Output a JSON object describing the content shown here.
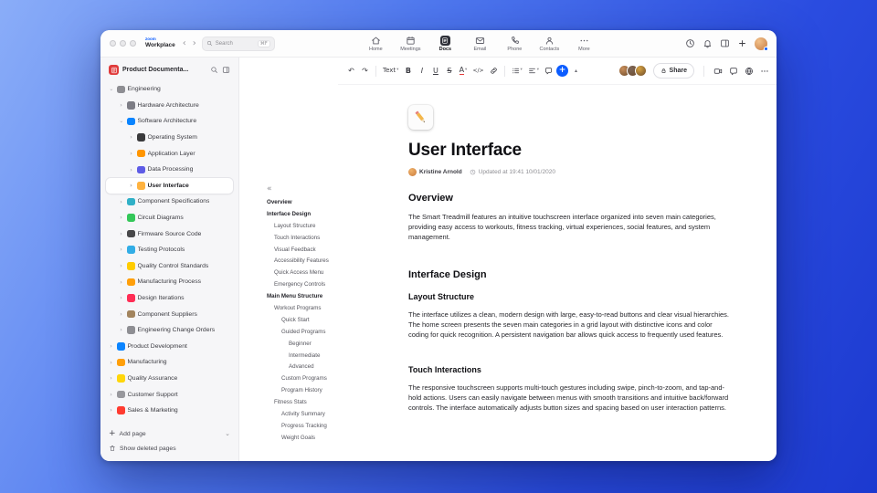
{
  "titlebar": {
    "brand_top": "zoom",
    "brand_bottom": "Workplace",
    "search_label": "Search",
    "search_shortcut": "⌘F",
    "tabs": [
      {
        "label": "Home",
        "icon": "home",
        "active": false
      },
      {
        "label": "Meetings",
        "icon": "calendar",
        "active": false
      },
      {
        "label": "Docs",
        "icon": "doc",
        "active": true
      },
      {
        "label": "Email",
        "icon": "mail",
        "active": false
      },
      {
        "label": "Phone",
        "icon": "phone",
        "active": false
      },
      {
        "label": "Contacts",
        "icon": "contacts",
        "active": false
      },
      {
        "label": "More",
        "icon": "more",
        "active": false
      }
    ]
  },
  "sidebar": {
    "title": "Product Documenta...",
    "tree": [
      {
        "label": "Engineering",
        "level": 0,
        "expanded": true,
        "icon": "gear",
        "color": "#8E8E93"
      },
      {
        "label": "Hardware Architecture",
        "level": 1,
        "expanded": false,
        "icon": "wrench",
        "color": "#7D7D85"
      },
      {
        "label": "Software Architecture",
        "level": 1,
        "expanded": true,
        "icon": "terminal",
        "color": "#0A84FF"
      },
      {
        "label": "Operating System",
        "level": 2,
        "expanded": false,
        "icon": "chip",
        "color": "#3A3A3C"
      },
      {
        "label": "Application Layer",
        "level": 2,
        "expanded": false,
        "icon": "layers",
        "color": "#FF9500"
      },
      {
        "label": "Data Processing",
        "level": 2,
        "expanded": false,
        "icon": "database",
        "color": "#5E5CE6"
      },
      {
        "label": "User Interface",
        "level": 2,
        "expanded": false,
        "icon": "palette",
        "color": "#FFB340",
        "selected": true
      },
      {
        "label": "Component Specifications",
        "level": 1,
        "expanded": false,
        "icon": "clipboard",
        "color": "#30B0C7"
      },
      {
        "label": "Circuit Diagrams",
        "level": 1,
        "expanded": false,
        "icon": "circuit",
        "color": "#34C759"
      },
      {
        "label": "Firmware Source Code",
        "level": 1,
        "expanded": false,
        "icon": "binary",
        "color": "#48484A"
      },
      {
        "label": "Testing Protocols",
        "level": 1,
        "expanded": false,
        "icon": "flask",
        "color": "#32ADE6"
      },
      {
        "label": "Quality Control Standards",
        "level": 1,
        "expanded": false,
        "icon": "medal",
        "color": "#FFCC00"
      },
      {
        "label": "Manufacturing Process",
        "level": 1,
        "expanded": false,
        "icon": "factory",
        "color": "#FF9F0A"
      },
      {
        "label": "Design Iterations",
        "level": 1,
        "expanded": false,
        "icon": "swatch",
        "color": "#FF2D55"
      },
      {
        "label": "Component Suppliers",
        "level": 1,
        "expanded": false,
        "icon": "box",
        "color": "#A2845E"
      },
      {
        "label": "Engineering Change Orders",
        "level": 1,
        "expanded": false,
        "icon": "file-edit",
        "color": "#8E8E93"
      },
      {
        "label": "Product Development",
        "level": 0,
        "expanded": false,
        "icon": "rocket",
        "color": "#0A84FF"
      },
      {
        "label": "Manufacturing",
        "level": 0,
        "expanded": false,
        "icon": "factory",
        "color": "#FF9F0A"
      },
      {
        "label": "Quality Assurance",
        "level": 0,
        "expanded": false,
        "icon": "trophy",
        "color": "#FFD60A"
      },
      {
        "label": "Customer Support",
        "level": 0,
        "expanded": false,
        "icon": "headset",
        "color": "#98989D"
      },
      {
        "label": "Sales & Marketing",
        "level": 0,
        "expanded": false,
        "icon": "megaphone",
        "color": "#FF3B30"
      }
    ],
    "add_page_label": "Add page",
    "show_deleted_label": "Show deleted pages"
  },
  "outline": {
    "items": [
      {
        "label": "Overview",
        "level": 0
      },
      {
        "label": "Interface Design",
        "level": 0
      },
      {
        "label": "Layout Structure",
        "level": 1
      },
      {
        "label": "Touch Interactions",
        "level": 1
      },
      {
        "label": "Visual Feedback",
        "level": 1
      },
      {
        "label": "Accessibility Features",
        "level": 1
      },
      {
        "label": "Quick Access Menu",
        "level": 1
      },
      {
        "label": "Emergency Controls",
        "level": 1
      },
      {
        "label": "Main Menu Structure",
        "level": 0
      },
      {
        "label": "Workout Programs",
        "level": 1
      },
      {
        "label": "Quick Start",
        "level": 2
      },
      {
        "label": "Guided Programs",
        "level": 2
      },
      {
        "label": "Beginner",
        "level": 3
      },
      {
        "label": "Intermediate",
        "level": 3
      },
      {
        "label": "Advanced",
        "level": 3
      },
      {
        "label": "Custom Programs",
        "level": 2
      },
      {
        "label": "Program History",
        "level": 2
      },
      {
        "label": "Fitness Stats",
        "level": 1
      },
      {
        "label": "Activity Summary",
        "level": 2
      },
      {
        "label": "Progress Tracking",
        "level": 2
      },
      {
        "label": "Weight Goals",
        "level": 2
      }
    ]
  },
  "toolbar": {
    "share_label": "Share",
    "avatar_colors": [
      "#c98e5a",
      "#7d6658",
      "#d9a441"
    ],
    "items": [
      {
        "name": "undo",
        "glyph": "↶"
      },
      {
        "name": "redo",
        "glyph": "↷"
      },
      {
        "name": "divider"
      },
      {
        "name": "text-style",
        "glyph": "Text",
        "chevron": true,
        "cls": "textstyle"
      },
      {
        "name": "bold",
        "glyph": "B",
        "cls": "bold"
      },
      {
        "name": "italic",
        "glyph": "I",
        "cls": "italic"
      },
      {
        "name": "underline",
        "glyph": "U",
        "cls": "underline"
      },
      {
        "name": "strikethrough",
        "glyph": "S",
        "cls": "strike"
      },
      {
        "name": "text-color",
        "glyph": "A",
        "chevron": true,
        "cls": "acolor"
      },
      {
        "name": "inline-code",
        "glyph": "</>",
        "cls": "code"
      },
      {
        "name": "link",
        "icon": "link"
      },
      {
        "name": "divider"
      },
      {
        "name": "bulleted-list",
        "icon": "list",
        "chevron": true
      },
      {
        "name": "alignment",
        "icon": "align",
        "chevron": true
      },
      {
        "name": "comment",
        "icon": "bubble"
      },
      {
        "name": "insert",
        "glyph": "+",
        "cls": "accent"
      },
      {
        "name": "collapse-toolbar",
        "glyph": "▴",
        "cls": "collapse"
      }
    ]
  },
  "doc": {
    "title": "User Interface",
    "author": "Kristine Arnold",
    "updated": "Updated at 19:41 10/01/2020",
    "body": [
      {
        "type": "h2",
        "text": "Overview"
      },
      {
        "type": "p",
        "text": "The Smart Treadmill features an intuitive touchscreen interface organized into seven main categories, providing easy access to workouts, fitness tracking, virtual experiences, social features, and system management."
      },
      {
        "type": "h2",
        "text": "Interface Design"
      },
      {
        "type": "h3",
        "text": "Layout Structure"
      },
      {
        "type": "p",
        "text": "The interface utilizes a clean, modern design with large, easy-to-read buttons and clear visual hierarchies. The home screen presents the seven main categories in a grid layout with distinctive icons and color coding for quick recognition. A persistent navigation bar allows quick access to frequently used features."
      },
      {
        "type": "h3",
        "text": "Touch Interactions"
      },
      {
        "type": "p",
        "text": "The responsive touchscreen supports multi-touch gestures including swipe, pinch-to-zoom, and tap-and-hold actions. Users can easily navigate between menus with smooth transitions and intuitive back/forward controls. The interface automatically adjusts button sizes and spacing based on user interaction patterns."
      }
    ]
  }
}
